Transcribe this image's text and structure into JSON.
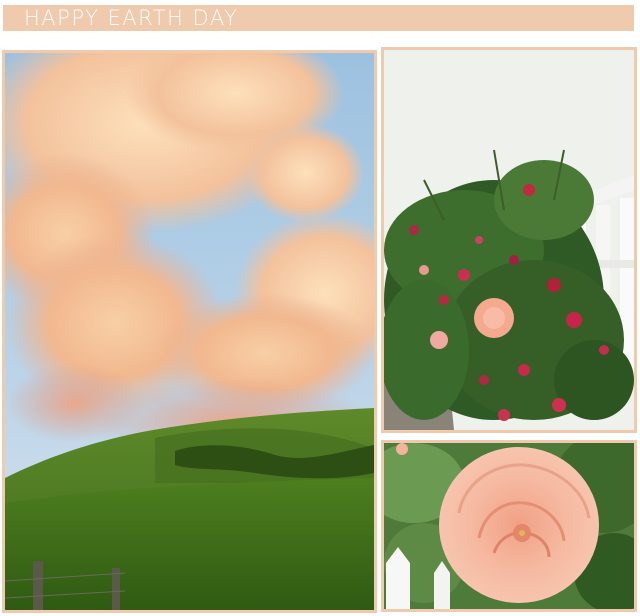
{
  "header": {
    "title": "HAPPY EARTH DAY"
  },
  "colors": {
    "banner": "#efcaad",
    "frame": "#efcaad",
    "title_text": "#ffffff"
  },
  "photos": [
    {
      "name": "sunset-hills-photo"
    },
    {
      "name": "rose-bush-fence-photo"
    },
    {
      "name": "peach-rose-closeup-photo"
    }
  ]
}
